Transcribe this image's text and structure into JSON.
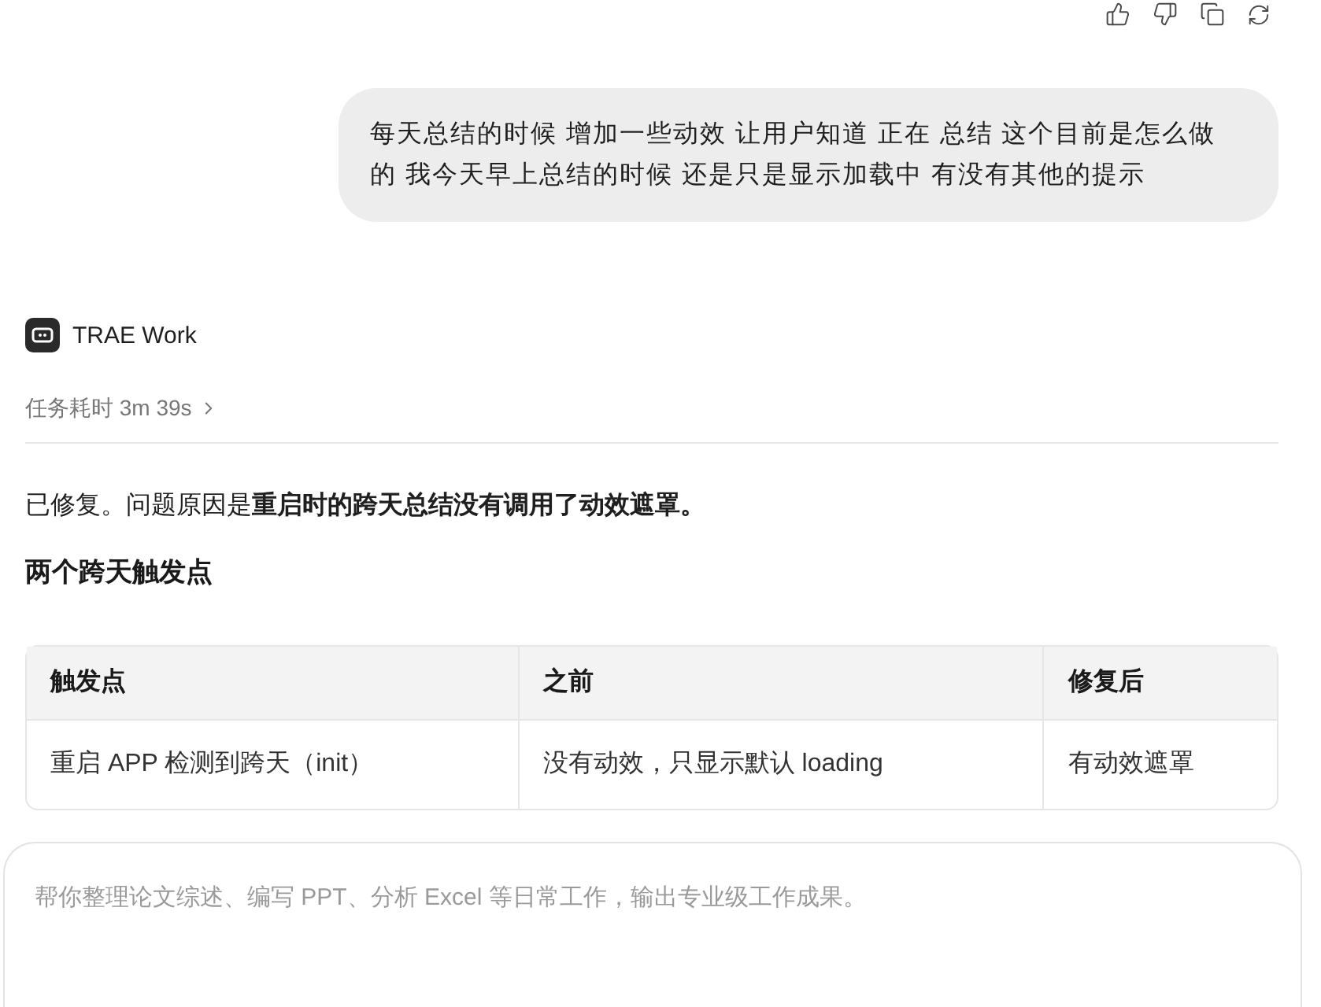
{
  "user_message": {
    "text": "每天总结的时候 增加一些动效 让用户知道 正在 总结 这个目前是怎么做的 我今天早上总结的时候 还是只是显示加载中 有没有其他的提示"
  },
  "assistant": {
    "name": "TRAE Work",
    "duration": "任务耗时 3m 39s",
    "expanded": false,
    "paragraph": "已修复。问题原因是**重启时的跨天总结没有调用了动效遮罩。**",
    "heading": "两个跨天触发点"
  },
  "table": {
    "columns": [
      "触发点",
      "之前",
      "修复后"
    ],
    "rows": [
      [
        "重启 APP 检测到跨天（init）",
        "没有动效，只显示默认 loading",
        "有动效遮罩"
      ]
    ]
  },
  "composer": {
    "placeholder": "帮你整理论文综述、编写 PPT、分析 Excel 等日常工作，输出专业级工作成果。"
  }
}
